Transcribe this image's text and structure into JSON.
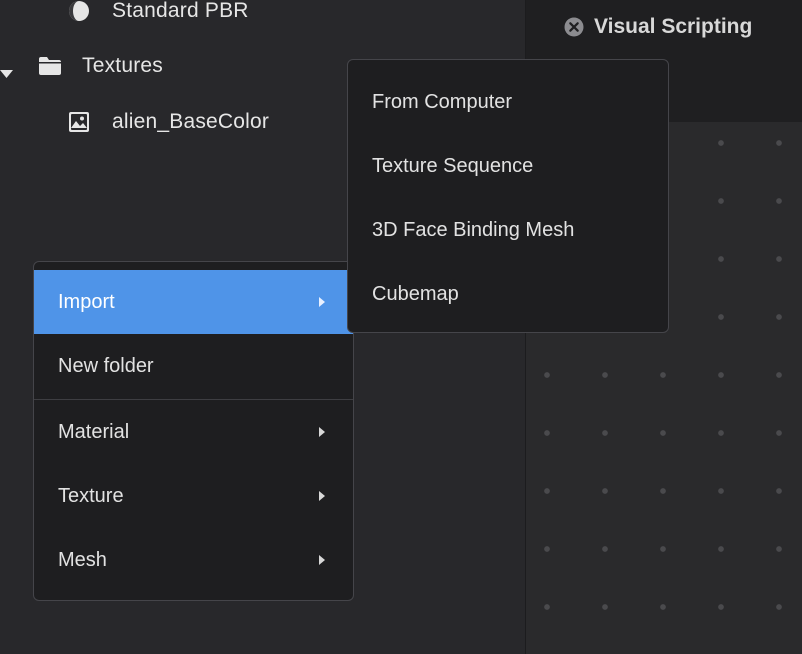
{
  "asset_tree": {
    "items": [
      {
        "label": "Standard PBR",
        "icon": "material-sphere-icon"
      },
      {
        "label": "Textures",
        "icon": "folder-icon",
        "expanded": true
      },
      {
        "label": "alien_BaseColor",
        "icon": "image-icon"
      }
    ]
  },
  "visual_scripting": {
    "title": "Visual Scripting",
    "close_icon": "close-circle-icon"
  },
  "context_menu": {
    "items": [
      {
        "label": "Import",
        "has_submenu": true,
        "active": true
      },
      {
        "label": "New folder",
        "has_submenu": false
      },
      {
        "label": "Material",
        "has_submenu": true
      },
      {
        "label": "Texture",
        "has_submenu": true
      },
      {
        "label": "Mesh",
        "has_submenu": true
      }
    ],
    "active_color": "#4f94e8"
  },
  "import_submenu": {
    "items": [
      {
        "label": "From Computer"
      },
      {
        "label": "Texture Sequence"
      },
      {
        "label": "3D Face Binding Mesh"
      },
      {
        "label": "Cubemap"
      }
    ]
  }
}
